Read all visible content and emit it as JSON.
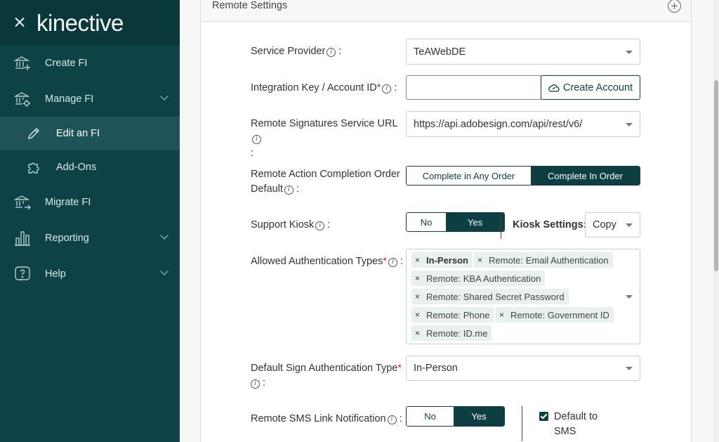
{
  "sidebar": {
    "logo": "kinective",
    "items": [
      {
        "label": "Create FI"
      },
      {
        "label": "Manage FI"
      },
      {
        "label": "Edit an FI"
      },
      {
        "label": "Add-Ons"
      },
      {
        "label": "Migrate FI"
      },
      {
        "label": "Reporting"
      },
      {
        "label": "Help"
      }
    ]
  },
  "panel": {
    "title": "Remote Settings"
  },
  "form": {
    "service_provider": {
      "label": "Service Provider",
      "value": "TeAWebDE"
    },
    "integration_key": {
      "label": "Integration Key / Account ID",
      "value": "",
      "button": "Create Account"
    },
    "service_url": {
      "label": "Remote Signatures Service URL",
      "value": "https://api.adobesign.com/api/rest/v6/"
    },
    "completion_order": {
      "label_line1": "Remote Action Completion Order",
      "label_line2": "Default",
      "options": [
        "Complete in Any Order",
        "Complete In Order"
      ],
      "selected": "Complete In Order"
    },
    "support_kiosk": {
      "label": "Support Kiosk",
      "options": [
        "No",
        "Yes"
      ],
      "selected": "Yes",
      "settings_label": "Kiosk Settings:",
      "settings_value": "Copy"
    },
    "auth_types": {
      "label": "Allowed Authentication Types",
      "tags": [
        "In-Person",
        "Remote: Email Authentication",
        "Remote: KBA Authentication",
        "Remote: Shared Secret Password",
        "Remote: Phone",
        "Remote: Government ID",
        "Remote: ID.me"
      ]
    },
    "default_sign_auth": {
      "label": "Default Sign Authentication Type",
      "value": "In-Person"
    },
    "sms_link": {
      "label": "Remote SMS Link Notification",
      "options": [
        "No",
        "Yes"
      ],
      "selected": "Yes",
      "checkbox_label_line1": "Default to",
      "checkbox_label_line2": "SMS",
      "checkbox_checked": true
    }
  },
  "colors": {
    "sidebar_bg": "#0d4346",
    "accent": "#0d3f42",
    "tag_bg": "#e8f1ee"
  }
}
